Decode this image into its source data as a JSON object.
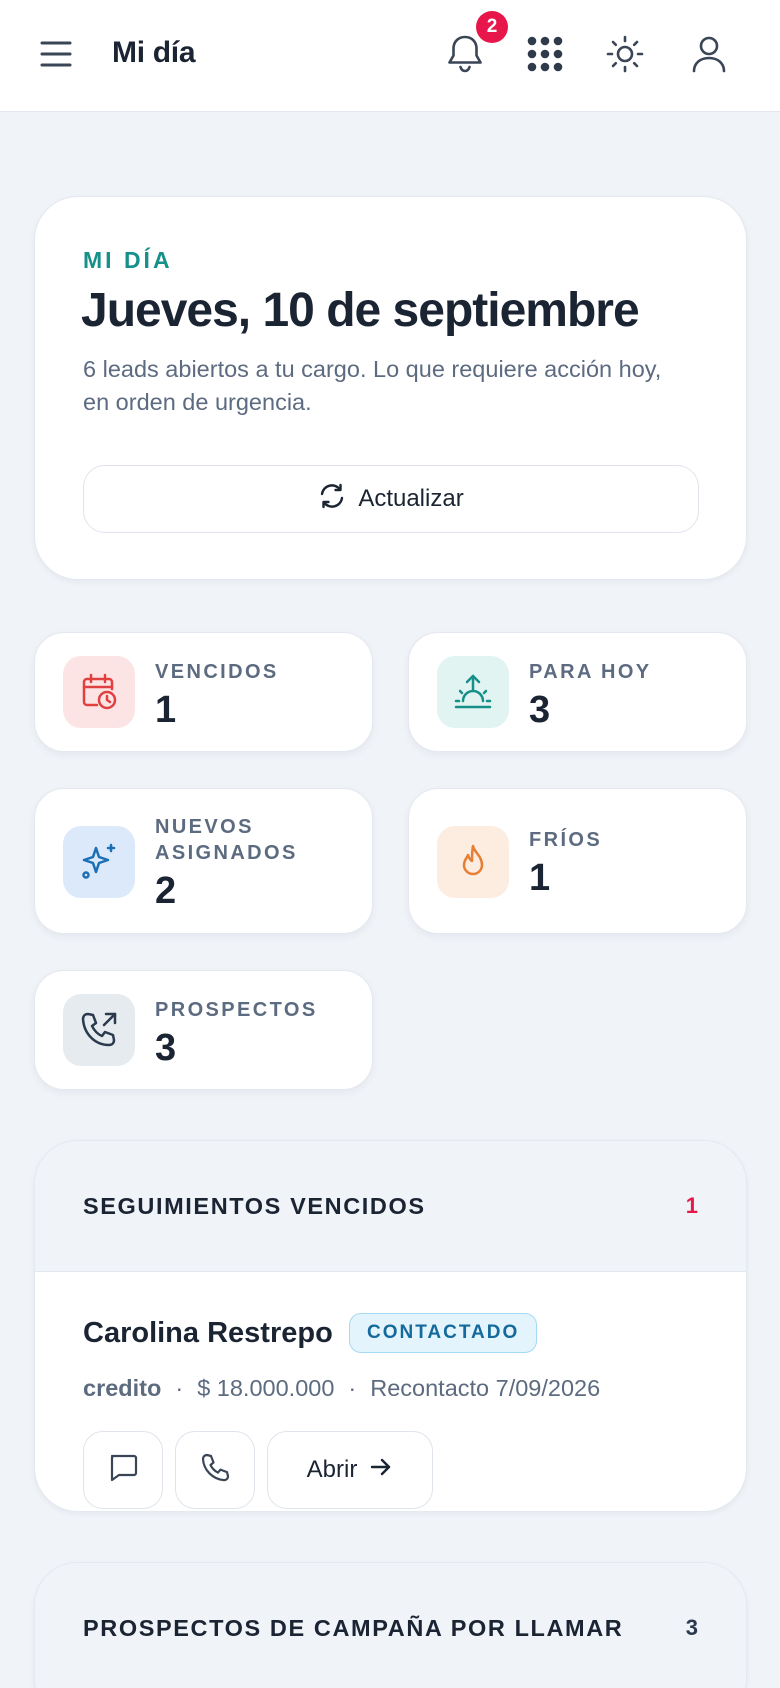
{
  "header": {
    "title": "Mi día",
    "notification_count": "2",
    "icons": [
      "menu-icon",
      "bell-icon",
      "apps-grid-icon",
      "sun-icon",
      "user-icon"
    ]
  },
  "hero": {
    "eyebrow": "MI DÍA",
    "date": "Jueves, 10 de septiembre",
    "description": "6 leads abiertos a tu cargo. Lo que requiere acción hoy, en orden de urgencia.",
    "refresh_label": "Actualizar"
  },
  "stats": [
    {
      "label": "VENCIDOS",
      "value": "1",
      "icon": "calendar-clock-icon",
      "color": "#e0403f",
      "bg": "#fde4e4"
    },
    {
      "label": "PARA HOY",
      "value": "3",
      "icon": "sunrise-icon",
      "color": "#17908a",
      "bg": "#e1f4f2"
    },
    {
      "label": "NUEVOS ASIGNADOS",
      "value": "2",
      "icon": "sparkles-icon",
      "color": "#1a6fb5",
      "bg": "#dce9fb"
    },
    {
      "label": "FRÍOS",
      "value": "1",
      "icon": "flame-icon",
      "color": "#e67e34",
      "bg": "#fdece0"
    },
    {
      "label": "PROSPECTOS",
      "value": "3",
      "icon": "phone-outgoing-icon",
      "color": "#2b3a4e",
      "bg": "#e6ebef"
    }
  ],
  "overdue_section": {
    "title": "SEGUIMIENTOS VENCIDOS",
    "count": "1",
    "count_color": "#e8174b",
    "lead": {
      "name": "Carolina Restrepo",
      "status": "CONTACTADO",
      "product": "credito",
      "amount": "$ 18.000.000",
      "recontact": "Recontacto 7/09/2026",
      "open_label": "Abrir"
    }
  },
  "prospects_section": {
    "title": "PROSPECTOS DE CAMPAÑA POR LLAMAR",
    "count": "3",
    "count_color": "#2b3a4e"
  },
  "colors": {
    "accent_teal": "#17908a",
    "danger": "#e8174b",
    "text": "#1b2433",
    "muted": "#5d6b80",
    "background": "#f0f3f8"
  }
}
